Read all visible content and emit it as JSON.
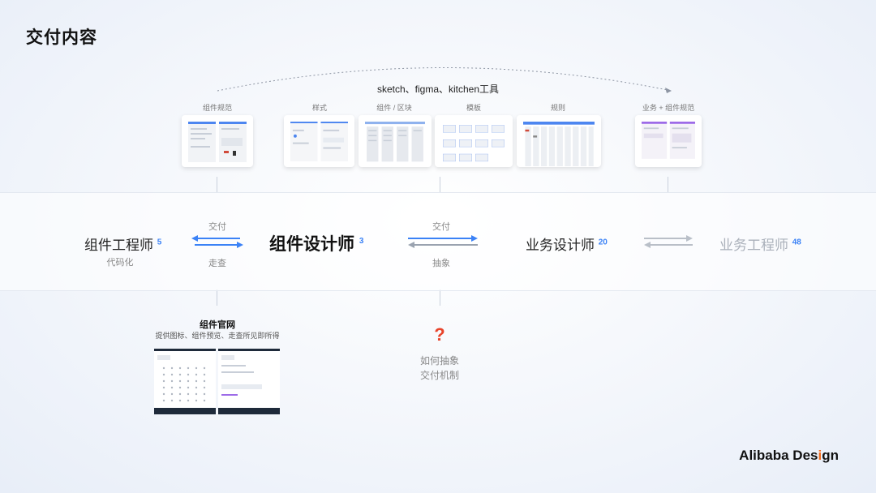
{
  "title": "交付内容",
  "tools_label": "sketch、figma、kitchen工具",
  "thumbnails": [
    {
      "label": "组件规范"
    },
    {
      "label": "样式"
    },
    {
      "label": "组件 / 区块"
    },
    {
      "label": "模板"
    },
    {
      "label": "规则"
    },
    {
      "label": "业务 + 组件规范"
    }
  ],
  "roles": [
    {
      "name": "组件工程师",
      "count": "5",
      "sub": "代码化"
    },
    {
      "name": "组件设计师",
      "count": "3"
    },
    {
      "name": "业务设计师",
      "count": "20"
    },
    {
      "name": "业务工程师",
      "count": "48"
    }
  ],
  "arrows": {
    "left_top": "交付",
    "left_bottom": "走查",
    "mid_top": "交付",
    "mid_bottom": "抽象"
  },
  "site": {
    "title": "组件官网",
    "subtitle": "提供图标、组件预览、走查所见即所得"
  },
  "question": {
    "mark": "?",
    "line1": "如何抽象",
    "line2": "交付机制"
  },
  "logo": {
    "text_before": "Alibaba Des",
    "accent": "i",
    "text_after": "gn"
  },
  "colors": {
    "accent_blue": "#3b82f6",
    "question_red": "#e8432a",
    "logo_orange": "#f26b1d"
  }
}
